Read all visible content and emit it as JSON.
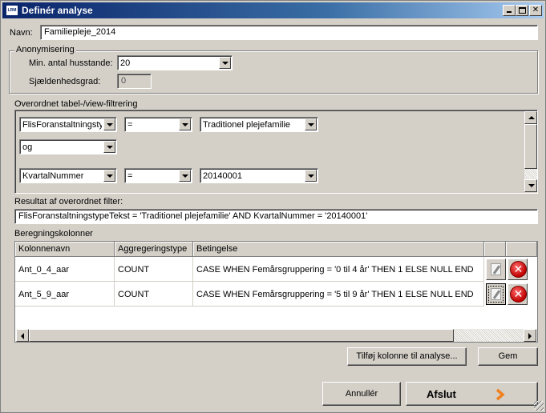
{
  "window": {
    "title": "Definér analyse",
    "app_icon_text": "LRM"
  },
  "name": {
    "label": "Navn:",
    "value": "Familiepleje_2014"
  },
  "anonymisering": {
    "title": "Anonymisering",
    "min_label": "Min. antal husstande:",
    "min_value": "20",
    "rarity_label": "Sjældenhedsgrad:",
    "rarity_value": "0"
  },
  "filter": {
    "title": "Overordnet tabel-/view-filtrering",
    "row1": {
      "field": "FlisForanstaltningstype",
      "op": "=",
      "value": "Traditionel plejefamilie"
    },
    "connector": "og",
    "row2": {
      "field": "KvartalNummer",
      "op": "=",
      "value": "20140001"
    }
  },
  "result": {
    "label": "Resultat af overordnet filter:",
    "value": "FlisForanstaltningstypeTekst = 'Traditionel plejefamilie' AND KvartalNummer = '20140001'"
  },
  "columns": {
    "title": "Beregningskolonner",
    "headers": [
      "Kolonnenavn",
      "Aggregeringstype",
      "Betingelse"
    ],
    "rows": [
      {
        "name": "Ant_0_4_aar",
        "agg": "COUNT",
        "cond": "CASE WHEN Femårsgruppering = '0 til 4 år' THEN 1 ELSE NULL END"
      },
      {
        "name": "Ant_5_9_aar",
        "agg": "COUNT",
        "cond": "CASE WHEN Femårsgruppering = '5 til 9 år' THEN 1 ELSE NULL END"
      }
    ]
  },
  "buttons": {
    "add_column": "Tilføj kolonne til analyse...",
    "save": "Gem",
    "cancel": "Annullér",
    "finish": "Afslut"
  },
  "colors": {
    "finish_arrow": "#f08020",
    "delete": "#c00000"
  }
}
